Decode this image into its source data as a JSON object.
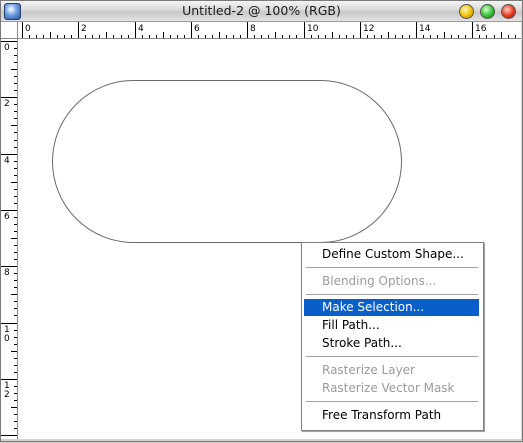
{
  "window": {
    "title": "Untitled-2 @ 100% (RGB)"
  },
  "rulers": {
    "horizontal_labels": [
      "0",
      "2",
      "4",
      "6",
      "8",
      "10",
      "12",
      "14",
      "16"
    ],
    "vertical_labels": [
      "0",
      "2",
      "4",
      "6",
      "8",
      "10",
      "12"
    ]
  },
  "context_menu": {
    "items": [
      {
        "label": "Define Custom Shape...",
        "enabled": true,
        "selected": false
      },
      {
        "label": "Blending Options...",
        "enabled": false,
        "selected": false
      },
      {
        "label": "Make Selection...",
        "enabled": true,
        "selected": true
      },
      {
        "label": "Fill Path...",
        "enabled": true,
        "selected": false
      },
      {
        "label": "Stroke Path...",
        "enabled": true,
        "selected": false
      },
      {
        "label": "Rasterize Layer",
        "enabled": false,
        "selected": false
      },
      {
        "label": "Rasterize Vector Mask",
        "enabled": false,
        "selected": false
      },
      {
        "label": "Free Transform Path",
        "enabled": true,
        "selected": false
      }
    ]
  },
  "colors": {
    "selection": "#0a5ec8",
    "disabled_text": "#9a9a9a"
  }
}
